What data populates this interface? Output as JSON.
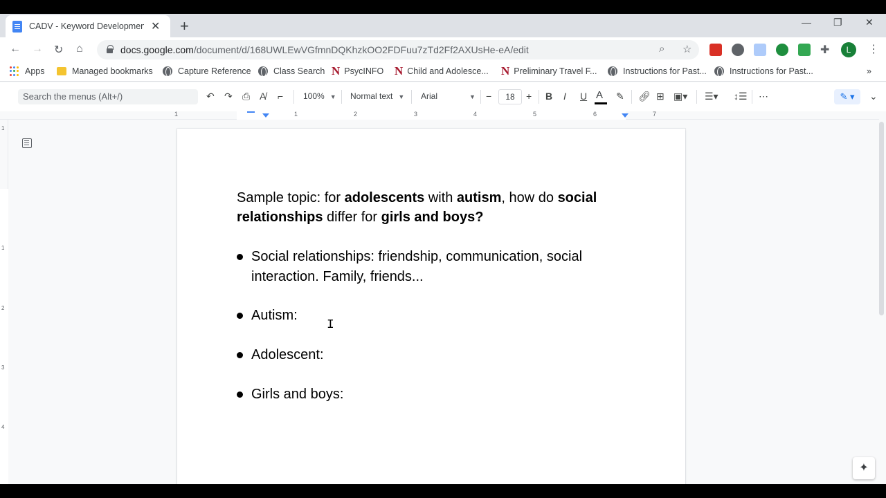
{
  "browser": {
    "tab_title": "CADV - Keyword Development -",
    "url_host": "docs.google.com",
    "url_path": "/document/d/168UWLEwVGfmnDQKhzkOO2FDFuu7zTd2Ff2AXUsHe-eA/edit",
    "avatar_letter": "L"
  },
  "bookmarks": [
    {
      "label": "Apps",
      "icon": "apps-grid-icon"
    },
    {
      "label": "Managed bookmarks",
      "icon": "folder-icon"
    },
    {
      "label": "Capture Reference",
      "icon": "globe-icon"
    },
    {
      "label": "Class Search",
      "icon": "globe-icon"
    },
    {
      "label": "PsycINFO",
      "icon": "n-logo-icon"
    },
    {
      "label": "Child and Adolesce...",
      "icon": "n-logo-icon"
    },
    {
      "label": "Preliminary Travel F...",
      "icon": "n-logo-icon"
    },
    {
      "label": "Instructions for Past...",
      "icon": "globe-icon"
    },
    {
      "label": "Instructions for Past...",
      "icon": "globe-icon"
    }
  ],
  "toolbar": {
    "menu_search_placeholder": "Search the menus (Alt+/)",
    "zoom": "100%",
    "style": "Normal text",
    "font": "Arial",
    "font_size": "18"
  },
  "ruler": {
    "numbers": [
      "1",
      "1",
      "2",
      "3",
      "4",
      "5",
      "6",
      "7"
    ],
    "vertical_numbers": [
      "1",
      "1",
      "2",
      "3",
      "4"
    ]
  },
  "document": {
    "topic_parts": [
      {
        "text": "Sample topic: for ",
        "bold": false
      },
      {
        "text": "adolescents",
        "bold": true
      },
      {
        "text": " with ",
        "bold": false
      },
      {
        "text": "autism",
        "bold": true
      },
      {
        "text": ", how do ",
        "bold": false
      },
      {
        "text": "social relationships",
        "bold": true
      },
      {
        "text": " differ for ",
        "bold": false
      },
      {
        "text": "girls and boys?",
        "bold": true
      }
    ],
    "bullets": [
      "Social relationships: friendship, communication, social interaction. Family, friends...",
      "Autism:",
      "Adolescent:",
      "Girls and boys:"
    ]
  }
}
